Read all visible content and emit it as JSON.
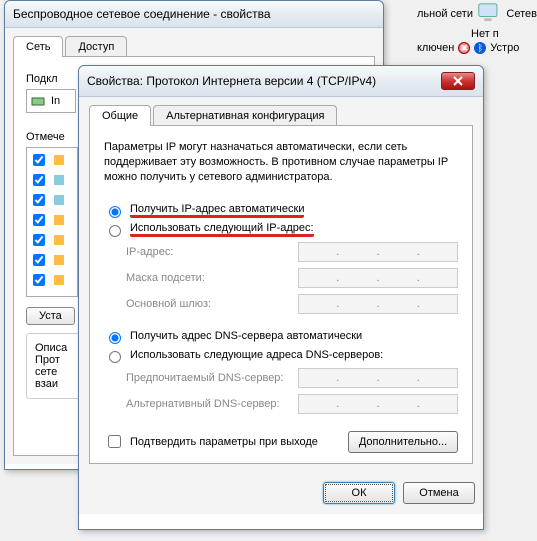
{
  "fragment": {
    "label1": "льной сети",
    "label2": "ключен",
    "status1": "Сетев",
    "status2": "Нет п",
    "status3": "Устро"
  },
  "bgwin": {
    "title": "Беспроводное сетевое соединение - свойства",
    "tabs": {
      "net": "Сеть",
      "access": "Доступ"
    },
    "conn_label": "Подкл",
    "item0": "In",
    "marked_label": "Отмече",
    "install_btn": "Уста",
    "desc_label": "Описа",
    "desc_l1": "Прот",
    "desc_l2": "сете",
    "desc_l3": "взаи"
  },
  "fgwin": {
    "title": "Свойства: Протокол Интернета версии 4 (TCP/IPv4)",
    "tabs": {
      "general": "Общие",
      "alt": "Альтернативная конфигурация"
    },
    "info": "Параметры IP могут назначаться автоматически, если сеть поддерживает эту возможность. В противном случае параметры IP можно получить у сетевого администратора.",
    "radio_auto_ip": "Получить IP-адрес автоматически",
    "radio_manual_ip": "Использовать следующий IP-адрес:",
    "lbl_ip": "IP-адрес:",
    "lbl_mask": "Маска подсети:",
    "lbl_gw": "Основной шлюз:",
    "radio_auto_dns": "Получить адрес DNS-сервера автоматически",
    "radio_manual_dns": "Использовать следующие адреса DNS-серверов:",
    "lbl_dns1": "Предпочитаемый DNS-сервер:",
    "lbl_dns2": "Альтернативный DNS-сервер:",
    "chk_validate": "Подтвердить параметры при выходе",
    "btn_adv": "Дополнительно...",
    "btn_ok": "ОК",
    "btn_cancel": "Отмена"
  }
}
